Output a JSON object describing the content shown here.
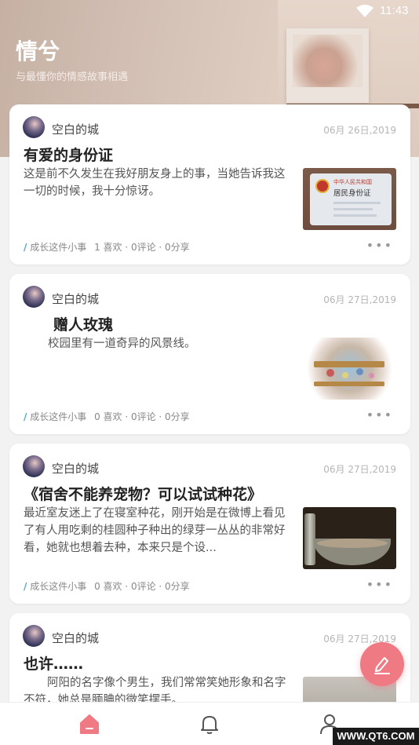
{
  "status_bar": {
    "time": "11:43"
  },
  "header": {
    "title": "情兮",
    "subtitle": "与最懂你的情感故事相遇"
  },
  "posts": [
    {
      "author": "空白的城",
      "date": "06月 26日,2019",
      "title": "有爱的身份证",
      "excerpt": "这是前不久发生在我好朋友身上的事，当她告诉我这一切的时候，我十分惊讶。",
      "category": "成长这件小事",
      "stats": "1 喜欢 · 0评论 · 0分享",
      "thumb_lines": [
        "中华人民共和国",
        "居民身份证"
      ]
    },
    {
      "author": "空白的城",
      "date": "06月 27日,2019",
      "title": "赠人玫瑰",
      "excerpt": "校园里有一道奇异的风景线。",
      "category": "成长这件小事",
      "stats": "0 喜欢 · 0评论 · 0分享"
    },
    {
      "author": "空白的城",
      "date": "06月 27日,2019",
      "title": "《宿舍不能养宠物？可以试试种花》",
      "excerpt": "最近室友迷上了在寝室种花，刚开始是在微博上看见了有人用吃剩的桂圆种子种出的绿芽一丛丛的非常好看，她就也想着去种，本来只是个设...",
      "category": "成长这件小事",
      "stats": "0 喜欢 · 0评论 · 0分享"
    },
    {
      "author": "空白的城",
      "date": "06月 27日,2019",
      "title": "也许……",
      "excerpt": "阿阳的名字像个男生，我们常常笑她形象和名字不符，她总是腼腆的微笑摆手。"
    }
  ],
  "tabs": [
    "home",
    "notifications",
    "profile"
  ],
  "watermark": "WWW.QT6.COM",
  "colors": {
    "accent": "#f07a84",
    "category_bar": "#4aa8d8"
  }
}
